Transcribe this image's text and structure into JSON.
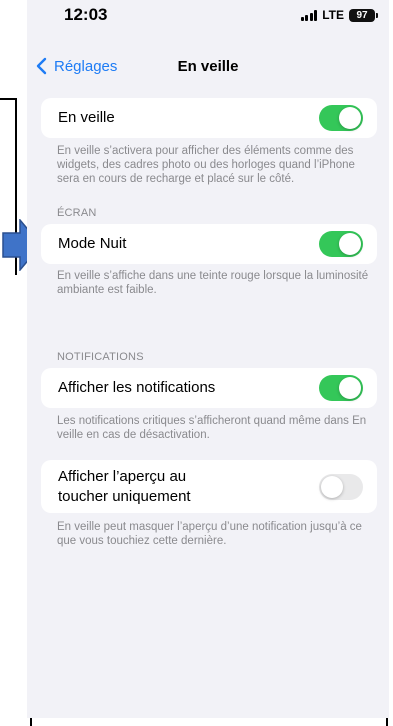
{
  "status_bar": {
    "time": "12:03",
    "network": "LTE",
    "battery": "97"
  },
  "nav": {
    "back_label": "Réglages",
    "title": "En veille"
  },
  "standby": {
    "label": "En veille",
    "toggle_on": true,
    "footer": "En veille s’activera pour afficher des éléments comme des widgets, des cadres photo ou des horloges quand l’iPhone sera en cours de recharge et placé sur le côté."
  },
  "screen_section": {
    "header": "ÉCRAN",
    "night_mode_label": "Mode Nuit",
    "night_mode_on": true,
    "footer": "En veille s’affiche dans une teinte rouge lorsque la luminosité ambiante est faible."
  },
  "notifications_section": {
    "header": "NOTIFICATIONS",
    "show_label": "Afficher les notifications",
    "show_on": true,
    "show_footer": "Les notifications critiques s’afficheront quand même dans En veille en cas de désactivation.",
    "preview_label_line1": "Afficher l’aperçu au",
    "preview_label_line2": "toucher uniquement",
    "preview_on": false,
    "preview_footer": "En veille peut masquer l’aperçu d’une notification jusqu’à ce que vous touchiez cette dernière."
  },
  "colors": {
    "accent": "#1e7cf5",
    "toggle_on": "#34c759",
    "toggle_off": "#e9e9ea",
    "annotation_arrow": "#3f73c8"
  }
}
